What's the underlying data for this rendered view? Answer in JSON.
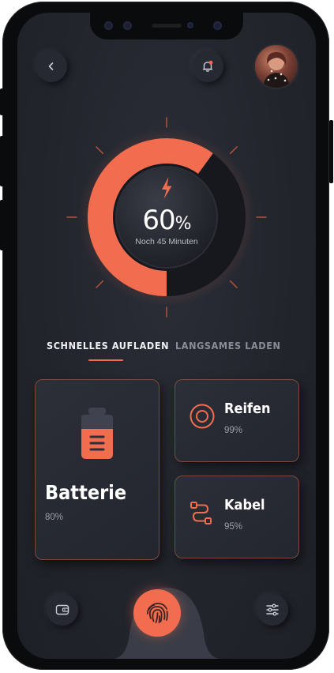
{
  "header": {
    "back_icon": "chevron-left-icon",
    "notification_icon": "bell-icon",
    "avatar_icon": "user-avatar"
  },
  "gauge": {
    "percent_value": "60",
    "percent_sign": "%",
    "remaining": "Noch 45 Minuten",
    "level": 0.6,
    "icon": "lightning-bolt-icon",
    "accent": "#f26d4f"
  },
  "tabs": {
    "active": "SCHNELLES AUFLADEN",
    "inactive": "LANGSAMES LADEN"
  },
  "cards": {
    "battery": {
      "title": "Batterie",
      "value": "80%",
      "icon": "battery-icon"
    },
    "tires": {
      "title": "Reifen",
      "value": "99%",
      "icon": "tire-icon"
    },
    "cable": {
      "title": "Kabel",
      "value": "95%",
      "icon": "cable-icon"
    }
  },
  "bottom_nav": {
    "left_icon": "wallet-icon",
    "center_icon": "fingerprint-icon",
    "right_icon": "sliders-icon"
  },
  "colors": {
    "accent": "#f26d4f",
    "background": "#23252d",
    "card_border": "#7a4a3e"
  }
}
